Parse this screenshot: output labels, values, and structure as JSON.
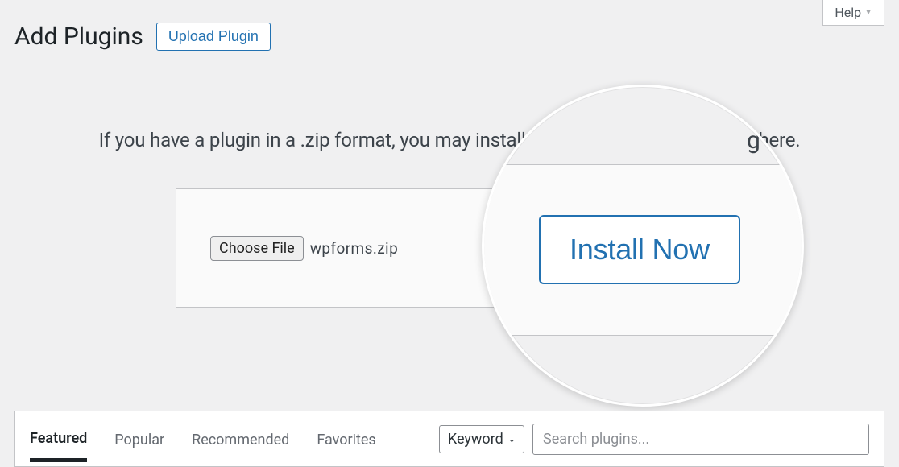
{
  "help": {
    "label": "Help"
  },
  "header": {
    "title": "Add Plugins",
    "upload_button": "Upload Plugin"
  },
  "upload": {
    "instruction": "If you have a plugin in a .zip format, you may install or update it by uploading it here.",
    "choose_file_label": "Choose File",
    "selected_filename": "wpforms.zip",
    "install_label": "Install Now"
  },
  "magnifier": {
    "instruction_fragment": "g it here."
  },
  "tabs": {
    "featured": "Featured",
    "popular": "Popular",
    "recommended": "Recommended",
    "favorites": "Favorites"
  },
  "search": {
    "filter_label": "Keyword",
    "placeholder": "Search plugins..."
  }
}
